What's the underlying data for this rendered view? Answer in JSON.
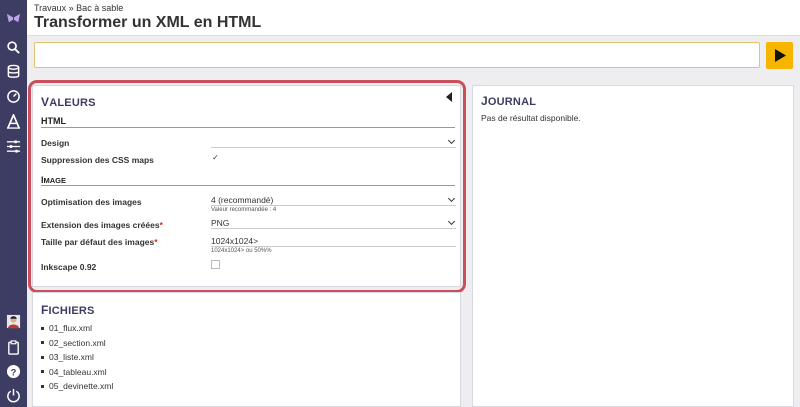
{
  "header": {
    "breadcrumb": "Travaux » Bac à sable",
    "title": "Transformer un XML en HTML"
  },
  "sidebar": {
    "icons": [
      "logo-icon",
      "search-icon",
      "database-icon",
      "gauge-icon",
      "font-icon",
      "sliders-icon",
      "avatar",
      "clipboard-icon",
      "help-icon",
      "power-icon"
    ]
  },
  "colors": {
    "sidebar": "#3d3c63",
    "run_button": "#f7b500",
    "highlight": "#c9505a",
    "panel_title": "#3d3c63"
  },
  "values": {
    "title_cap": "V",
    "title_rest": "ALEURS",
    "html_section": "HTML",
    "design_label": "Design",
    "design_value": "",
    "css_maps_label": "Suppression des CSS maps",
    "css_maps_checked": "✓",
    "image_section_cap": "I",
    "image_section_rest": "MAGE",
    "opt_label": "Optimisation des images",
    "opt_value": "4 (recommandé)",
    "opt_hint": "Valeur recommandée : 4",
    "ext_label": "Extension des images créées",
    "ext_value": "PNG",
    "size_label": "Taille par défaut des images",
    "size_value": "1024x1024>",
    "size_hint": "1024x1024> ou 50%%",
    "inkscape_label": "Inkscape 0.92",
    "required_mark": "*"
  },
  "files": {
    "title_cap": "F",
    "title_rest": "ICHIERS",
    "items": [
      "01_flux.xml",
      "02_section.xml",
      "03_liste.xml",
      "04_tableau.xml",
      "05_devinette.xml"
    ]
  },
  "journal": {
    "title_cap": "J",
    "title_rest": "OURNAL",
    "empty_text": "Pas de résultat disponible."
  }
}
